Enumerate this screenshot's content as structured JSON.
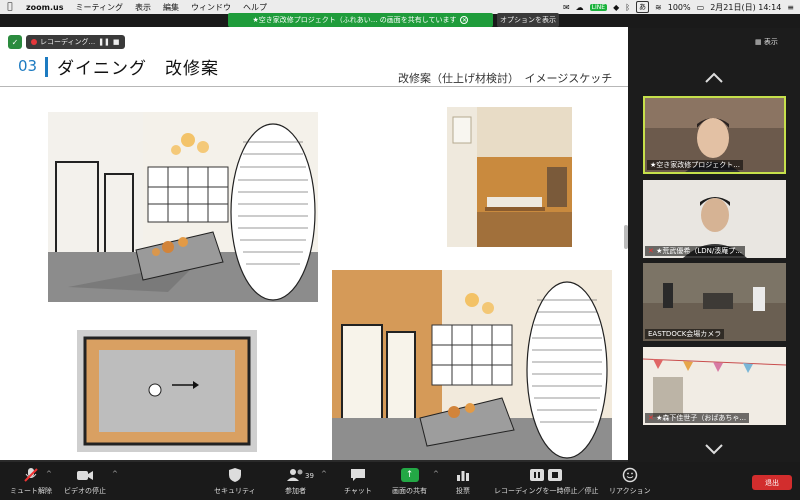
{
  "menubar": {
    "app_name": "zoom.us",
    "items": [
      "ミーティング",
      "表示",
      "編集",
      "ウィンドウ",
      "ヘルプ"
    ],
    "status": {
      "line_badge": "LINE",
      "ime_badge": "あ",
      "battery": "100%",
      "date_time": "2月21日(日)  14:14"
    }
  },
  "share_banner": {
    "text": "★空き家改修プロジェクト（ふれあい... の画面を共有しています",
    "options_label": "オプションを表示"
  },
  "recording": {
    "label": "レコーディング..."
  },
  "slide": {
    "section_number": "03",
    "title": "ダイニング　改修案",
    "subtitle": "改修案（仕上げ材検討）　イメージスケッチ"
  },
  "panel": {
    "view_label": "表示",
    "participants": [
      {
        "name": "★空き家改修プロジェクト..."
      },
      {
        "name": "★荒武優希（LDN/湊庵プ..."
      },
      {
        "name": "EASTDOCK会場カメラ"
      },
      {
        "name": "★森下佳世子（おばあちゃ..."
      }
    ]
  },
  "toolbar": {
    "unmute": "ミュート解除",
    "stop_video": "ビデオの停止",
    "security": "セキュリティ",
    "participants": "参加者",
    "participant_count": "39",
    "chat": "チャット",
    "share_screen": "画面の共有",
    "polls": "投票",
    "pause_recording": "レコーディングを一時停止／停止",
    "reactions": "リアクション",
    "end": "退出"
  },
  "colors": {
    "accent_blue": "#1d7bc1",
    "share_green": "#1f9c3b",
    "active_speaker": "#c6e04b",
    "end_red": "#d22d2d"
  }
}
